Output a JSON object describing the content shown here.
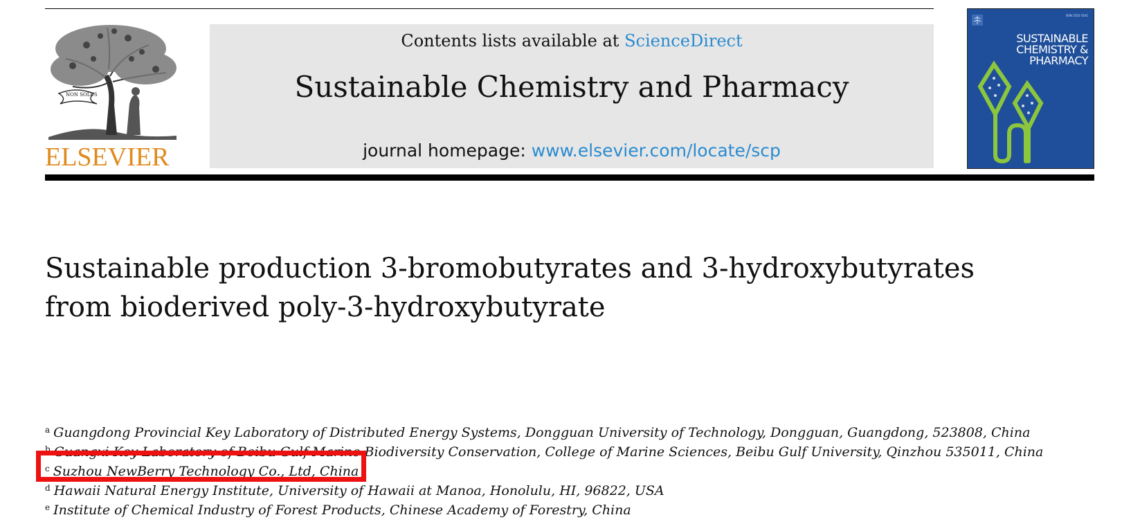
{
  "header": {
    "publisher_logo_text": "ELSEVIER",
    "logo_motto": "NON SOLUS",
    "contents_prefix": "Contents lists available at ",
    "contents_link": "ScienceDirect",
    "journal_title": "Sustainable Chemistry and Pharmacy",
    "homepage_prefix": "journal homepage: ",
    "homepage_link": "www.elsevier.com/locate/scp"
  },
  "cover": {
    "title_lines": [
      "SUSTAINABLE",
      "CHEMISTRY &",
      "PHARMACY"
    ],
    "issn": "ISSN 2352-5541"
  },
  "article": {
    "title_line1": "Sustainable production 3-bromobutyrates and 3-hydroxybutyrates",
    "title_line2": "from bioderived poly-3-hydroxybutyrate"
  },
  "affiliations": [
    {
      "mark": "a",
      "text": "Guangdong Provincial Key Laboratory of Distributed Energy Systems, Dongguan University of Technology, Dongguan, Guangdong, 523808, China"
    },
    {
      "mark": "b",
      "text": "Guangxi Key Laboratory of Beibu Gulf Marine Biodiversity Conservation, College of Marine Sciences, Beibu Gulf University, Qinzhou 535011, China"
    },
    {
      "mark": "c",
      "text": "Suzhou NewBerry Technology Co., Ltd, China"
    },
    {
      "mark": "d",
      "text": "Hawaii Natural Energy Institute, University of Hawaii at Manoa, Honolulu, HI, 96822, USA"
    },
    {
      "mark": "e",
      "text": "Institute of Chemical Industry of Forest Products, Chinese Academy of Forestry, China"
    }
  ],
  "colors": {
    "link": "#2a8bd0",
    "elsevier_orange": "#e08a1e",
    "highlight": "#ee1111",
    "cover_blue": "#1f4f9a",
    "cover_leaf": "#8cc63f"
  }
}
